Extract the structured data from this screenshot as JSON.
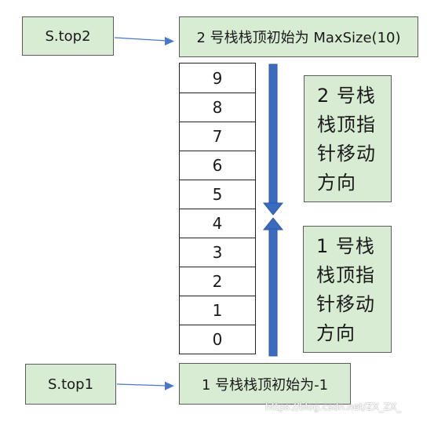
{
  "labels": {
    "s_top2": "S.top2",
    "s_top1": "S.top1",
    "top2_init": "2 号栈栈顶初始为 MaxSize(10)",
    "top1_init": "1 号栈栈顶初始为-1"
  },
  "direction_boxes": {
    "stack2": [
      "2 号栈",
      "栈顶指",
      "针移动",
      "方向"
    ],
    "stack1": [
      "1 号栈",
      "栈顶指",
      "针移动",
      "方向"
    ]
  },
  "stack_cells": [
    "9",
    "8",
    "7",
    "6",
    "5",
    "4",
    "3",
    "2",
    "1",
    "0"
  ],
  "watermark": "https://blog.csdn.net/ZX_ZX_",
  "colors": {
    "box_fill": "#d7ecd3",
    "arrow_blue": "#3a6bbf",
    "thin_arrow": "#4a78c8"
  }
}
